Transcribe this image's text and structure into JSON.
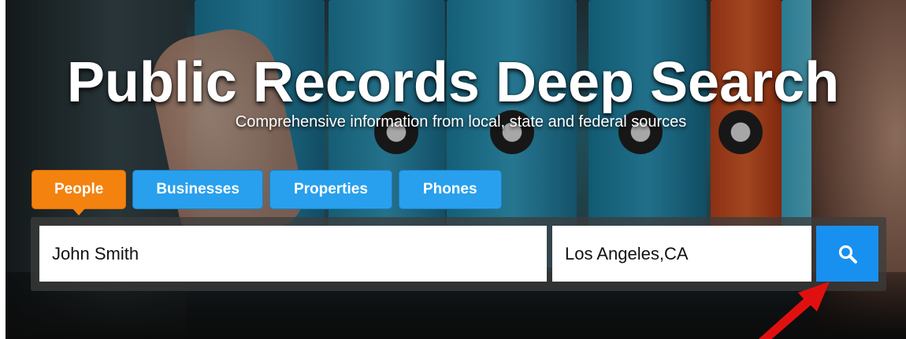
{
  "hero": {
    "title": "Public Records Deep Search",
    "subtitle": "Comprehensive information from local, state and federal sources"
  },
  "tabs": [
    {
      "label": "People",
      "active": true
    },
    {
      "label": "Businesses",
      "active": false
    },
    {
      "label": "Properties",
      "active": false
    },
    {
      "label": "Phones",
      "active": false
    }
  ],
  "search": {
    "name_value": "John Smith",
    "location_value": "Los Angeles,CA",
    "button_icon": "search-icon"
  },
  "colors": {
    "tab_active": "#f4820f",
    "tab_inactive": "#28a0ee",
    "search_button": "#1890f0",
    "annotation_arrow": "#e01010"
  }
}
